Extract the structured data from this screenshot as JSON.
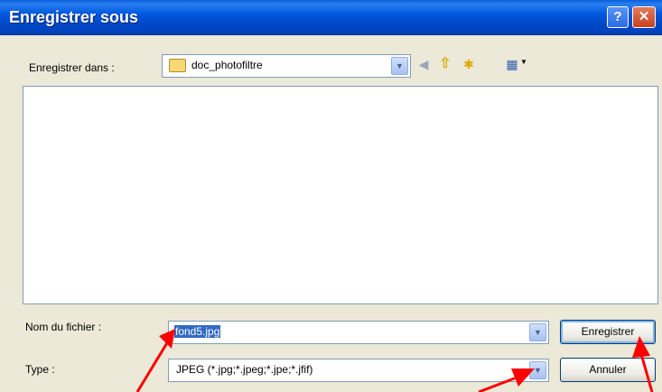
{
  "window": {
    "title": "Enregistrer sous",
    "help_glyph": "?",
    "close_glyph": "✕"
  },
  "location": {
    "label": "Enregistrer dans :",
    "value": "doc_photofiltre",
    "icons": [
      "folder-icon",
      "chevron-down-icon",
      "back-icon",
      "up-folder-icon",
      "new-folder-icon",
      "views-icon"
    ]
  },
  "file_list": {
    "items": []
  },
  "filename": {
    "label": "Nom du fichier :",
    "value": "fond5.jpg"
  },
  "type": {
    "label": "Type :",
    "value": "JPEG (*.jpg;*.jpeg;*.jpe;*.jfif)"
  },
  "buttons": {
    "save": "Enregistrer",
    "cancel": "Annuler"
  },
  "annotations": {
    "arrow_color": "#ff0000",
    "arrow_count": 3
  },
  "colors": {
    "titlebar": "#0050d8",
    "dialog_bg": "#ece9d8",
    "selection": "#316ac5"
  }
}
